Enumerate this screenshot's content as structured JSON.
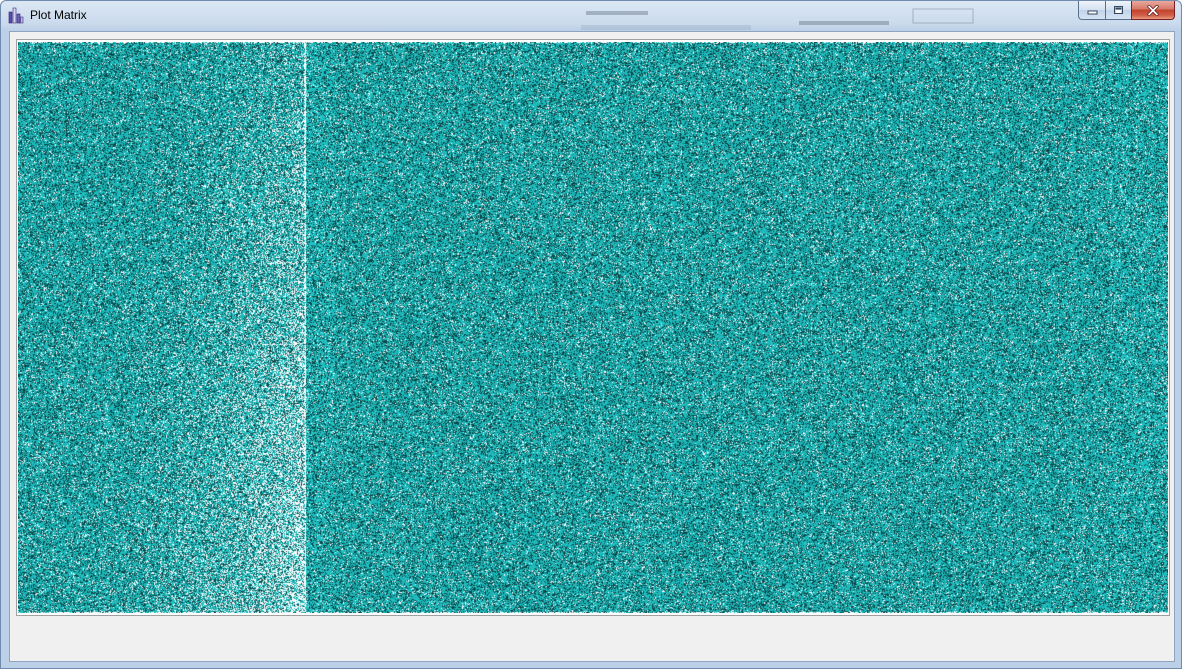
{
  "window": {
    "title": "Plot Matrix",
    "icon": "bar-chart-app-icon",
    "caption_buttons": {
      "minimize": "minimize-icon",
      "maximize": "maximize-icon",
      "close": "close-icon"
    }
  },
  "plot": {
    "kind": "matrix-heatmap",
    "colors": {
      "background": "#ffffff",
      "dense": "#0f6363",
      "mid": "#139393",
      "bright": "#1fc4c4"
    }
  }
}
